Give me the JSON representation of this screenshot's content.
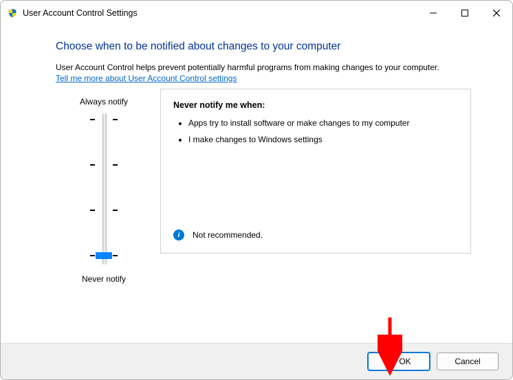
{
  "window": {
    "title": "User Account Control Settings"
  },
  "heading": "Choose when to be notified about changes to your computer",
  "description": "User Account Control helps prevent potentially harmful programs from making changes to your computer.",
  "link_text": "Tell me more about User Account Control settings",
  "slider": {
    "top_label": "Always notify",
    "bottom_label": "Never notify",
    "levels": 4,
    "current_level": 0
  },
  "panel": {
    "title": "Never notify me when:",
    "bullets": [
      "Apps try to install software or make changes to my computer",
      "I make changes to Windows settings"
    ],
    "recommendation": "Not recommended."
  },
  "buttons": {
    "ok": "OK",
    "cancel": "Cancel"
  },
  "icons": {
    "shield": "uac-shield-icon",
    "info": "info-icon",
    "minimize": "minimize-icon",
    "maximize": "maximize-icon",
    "close": "close-icon"
  }
}
